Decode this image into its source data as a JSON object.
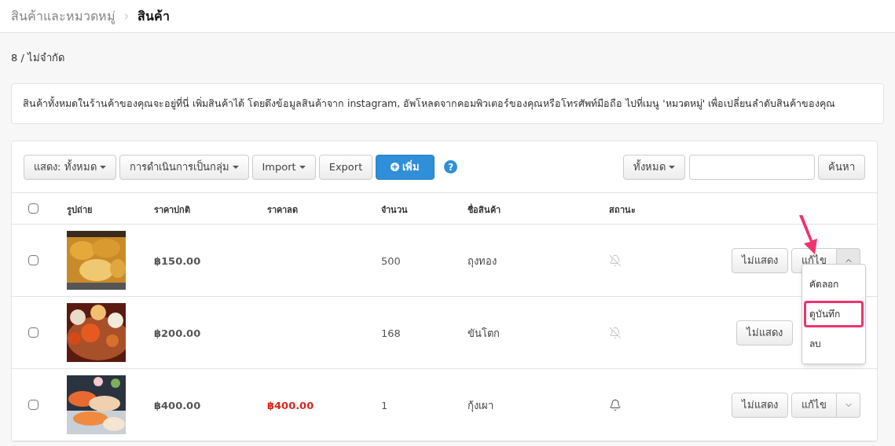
{
  "breadcrumb": {
    "parent": "สินค้าและหมวดหมู่",
    "current": "สินค้า"
  },
  "count": "8 / ไม่จำกัด",
  "info": "สินค้าทั้งหมดในร้านค้าของคุณจะอยู่ที่นี่ เพิ่มสินค้าได้ โดยดึงข้อมูลสินค้าจาก instagram, อัพโหลดจากคอมพิวเตอร์ของคุณหรือโทรศัพท์มือถือ ไปที่เมนู 'หมวดหมู่' เพื่อเปลี่ยนลำดับสินค้าของคุณ",
  "toolbar": {
    "buttons": [
      {
        "label": "แสดง: ทั้งหมด",
        "kind": "dropdown"
      },
      {
        "label": "การดำเนินการเป็นกลุ่ม",
        "kind": "dropdown"
      },
      {
        "label": "Import",
        "kind": "dropdown"
      },
      {
        "label": "Export",
        "kind": "plain"
      },
      {
        "label": "เพิ่ม",
        "kind": "primary"
      }
    ],
    "help": "?",
    "filter": "ทั้งหมด",
    "search_button": "ค้นหา"
  },
  "table": {
    "select_all": false,
    "columns": [
      "รูปถ่าย",
      "ราคาปกติ",
      "ราคาลด",
      "จำนวน",
      "ชื่อสินค้า",
      "สถานะ"
    ],
    "rows": [
      {
        "checked": false,
        "price": "฿150.00",
        "quantity": "500",
        "name": "ถุงทอง",
        "notify": false,
        "hide_button": "ไม่แสดง",
        "edit_button": "แก้ไข",
        "expanded": true,
        "menu": [
          {
            "label": "คัดลอก",
            "highlighted": false
          },
          {
            "label": "ดูบันทึก",
            "highlighted": true
          },
          {
            "label": "ลบ",
            "highlighted": false
          }
        ]
      },
      {
        "checked": false,
        "price": "฿200.00",
        "quantity": "168",
        "name": "ขันโตก",
        "notify": false,
        "hide_button": "ไม่แสดง"
      },
      {
        "checked": false,
        "price": "฿400.00",
        "sale_price": "฿400.00",
        "quantity": "1",
        "name": "กุ้งเผา",
        "notify": true,
        "hide_button": "ไม่แสดง",
        "edit_button": "แก้ไข",
        "expanded": false
      }
    ]
  }
}
